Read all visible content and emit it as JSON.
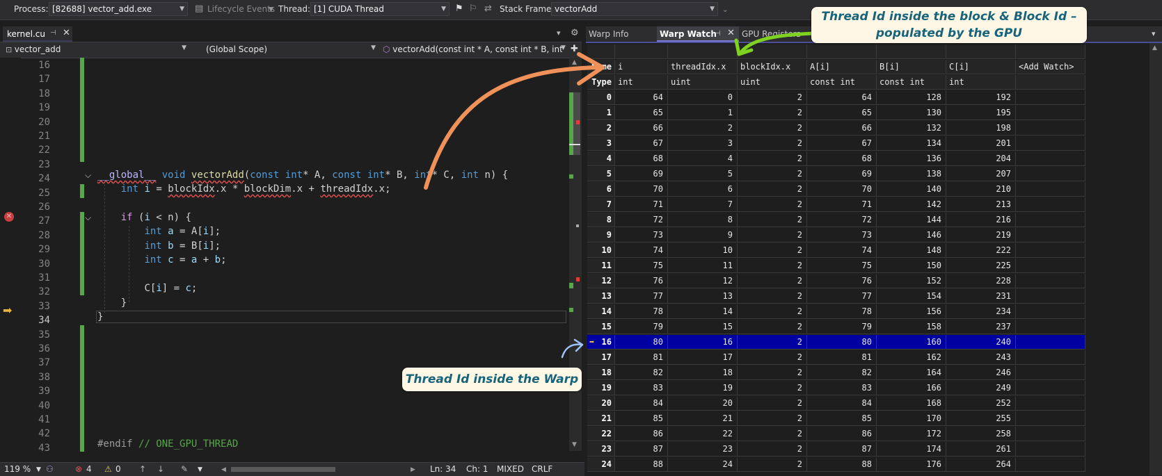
{
  "toolbar": {
    "process_label": "Process:",
    "process_value": "[82688] vector_add.exe",
    "lifecycle_label": "Lifecycle Events",
    "thread_label": "Thread:",
    "thread_value": "[1] CUDA Thread",
    "stack_frame_label": "Stack Frame:",
    "stack_frame_value": "vectorAdd"
  },
  "editor": {
    "tab_title": "kernel.cu",
    "nav_project": "vector_add",
    "nav_scope": "(Global Scope)",
    "nav_function": "vectorAdd(const int * A, const int * B, int * C",
    "line_numbers": [
      "16",
      "17",
      "18",
      "19",
      "20",
      "21",
      "22",
      "23",
      "24",
      "25",
      "26",
      "27",
      "28",
      "29",
      "30",
      "31",
      "32",
      "33",
      "34",
      "35",
      "36",
      "37",
      "38",
      "39",
      "40",
      "41",
      "42",
      "43"
    ],
    "current_line": "34",
    "code": {
      "l24": [
        "__global__",
        "void",
        "vectorAdd",
        "(",
        "const",
        "int",
        "* A, ",
        "const",
        "int",
        "* B, ",
        "int",
        "* C, ",
        "int",
        " n) {"
      ],
      "l25": [
        "int",
        "i",
        "blockIdx",
        "blockDim",
        "threadIdx"
      ],
      "l27": [
        "if",
        " (",
        "i",
        " < n) {"
      ],
      "l28": [
        "int",
        "a",
        "A",
        "i"
      ],
      "l29": [
        "int",
        "b",
        "B",
        "i"
      ],
      "l30": [
        "int",
        "c",
        "a",
        "b"
      ],
      "l32": [
        "C",
        "i",
        "c"
      ],
      "l33": "}",
      "l34": "}",
      "l43": [
        "#endif",
        "// ONE_GPU_THREAD"
      ]
    }
  },
  "status": {
    "zoom": "119 %",
    "errors": "4",
    "warnings": "0",
    "ln": "Ln: 34",
    "ch": "Ch: 1",
    "mixed": "MIXED",
    "crlf": "CRLF"
  },
  "warp_panel": {
    "tabs": [
      "Warp Info",
      "Warp Watch",
      "GPU Registers"
    ],
    "name_header": "Name",
    "type_header": "Type",
    "columns": [
      {
        "name": "i",
        "type": "int"
      },
      {
        "name": "threadIdx.x",
        "type": "uint"
      },
      {
        "name": "blockIdx.x",
        "type": "uint"
      },
      {
        "name": "A[i]",
        "type": "const int"
      },
      {
        "name": "B[i]",
        "type": "const int"
      },
      {
        "name": "C[i]",
        "type": "int"
      },
      {
        "name": "<Add Watch>",
        "type": ""
      }
    ],
    "rows": [
      [
        0,
        64,
        0,
        2,
        64,
        128,
        192
      ],
      [
        1,
        65,
        1,
        2,
        65,
        130,
        195
      ],
      [
        2,
        66,
        2,
        2,
        66,
        132,
        198
      ],
      [
        3,
        67,
        3,
        2,
        67,
        134,
        201
      ],
      [
        4,
        68,
        4,
        2,
        68,
        136,
        204
      ],
      [
        5,
        69,
        5,
        2,
        69,
        138,
        207
      ],
      [
        6,
        70,
        6,
        2,
        70,
        140,
        210
      ],
      [
        7,
        71,
        7,
        2,
        71,
        142,
        213
      ],
      [
        8,
        72,
        8,
        2,
        72,
        144,
        216
      ],
      [
        9,
        73,
        9,
        2,
        73,
        146,
        219
      ],
      [
        10,
        74,
        10,
        2,
        74,
        148,
        222
      ],
      [
        11,
        75,
        11,
        2,
        75,
        150,
        225
      ],
      [
        12,
        76,
        12,
        2,
        76,
        152,
        228
      ],
      [
        13,
        77,
        13,
        2,
        77,
        154,
        231
      ],
      [
        14,
        78,
        14,
        2,
        78,
        156,
        234
      ],
      [
        15,
        79,
        15,
        2,
        79,
        158,
        237
      ],
      [
        16,
        80,
        16,
        2,
        80,
        160,
        240
      ],
      [
        17,
        81,
        17,
        2,
        81,
        162,
        243
      ],
      [
        18,
        82,
        18,
        2,
        82,
        164,
        246
      ],
      [
        19,
        83,
        19,
        2,
        83,
        166,
        249
      ],
      [
        20,
        84,
        20,
        2,
        84,
        168,
        252
      ],
      [
        21,
        85,
        21,
        2,
        85,
        170,
        255
      ],
      [
        22,
        86,
        22,
        2,
        86,
        172,
        258
      ],
      [
        23,
        87,
        23,
        2,
        87,
        174,
        261
      ],
      [
        24,
        88,
        24,
        2,
        88,
        176,
        264
      ]
    ],
    "selected_row": 16
  },
  "annotations": {
    "top": "Thread Id inside the block & Block Id – populated by the GPU",
    "bottom": "Thread Id inside the Warp"
  },
  "colors": {
    "accent": "#0000a0",
    "callout_text": "#17647a",
    "arrow_orange": "#f0915a",
    "arrow_green": "#7ed321",
    "arrow_blue": "#9ec3ff"
  }
}
